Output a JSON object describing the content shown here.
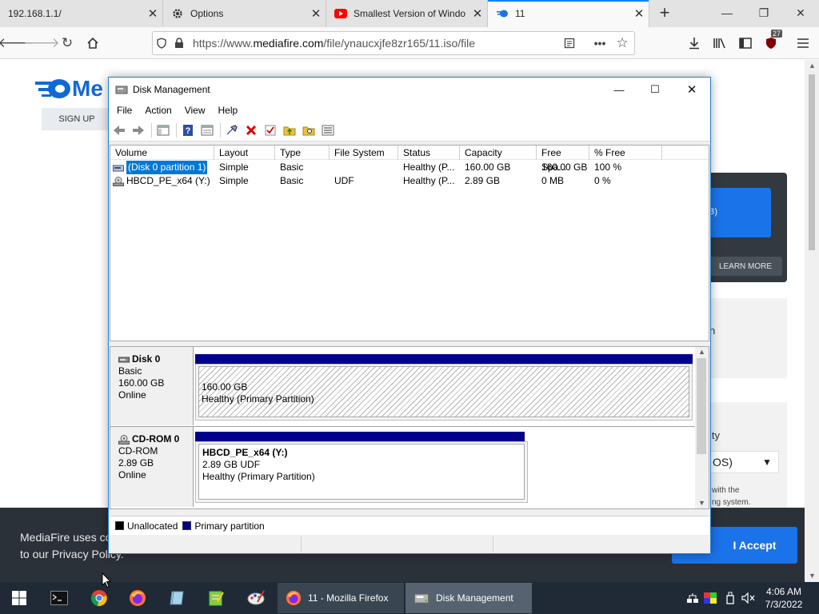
{
  "browser": {
    "tabs": [
      {
        "title": "192.168.1.1/",
        "active": false
      },
      {
        "title": "Options",
        "active": false
      },
      {
        "title": "Smallest Version of Windo",
        "active": false
      },
      {
        "title": "11",
        "active": true
      }
    ],
    "url_prefix": "https://www.",
    "url_host": "mediafire.com",
    "url_path": "/file/ynaucxjfe8zr165/11.iso/file",
    "extension_badge": "27"
  },
  "page": {
    "logo": "Me",
    "signup": "SIGN UP",
    "download_suffix": "B)",
    "learn_more": "LEARN MORE",
    "side_h": "h",
    "side_ity": "ity",
    "os_select": "OS)",
    "side_small_1": "with the",
    "side_small_2": "ng system.",
    "cookie_line1": "MediaFire uses coo",
    "cookie_line2": "to our Privacy Policy.",
    "accept": "I Accept"
  },
  "dm": {
    "title": "Disk Management",
    "menu": [
      "File",
      "Action",
      "View",
      "Help"
    ],
    "columns": [
      "Volume",
      "Layout",
      "Type",
      "File System",
      "Status",
      "Capacity",
      "Free Spa...",
      "% Free"
    ],
    "volumes": [
      {
        "volume": "(Disk 0 partition 1)",
        "layout": "Simple",
        "type": "Basic",
        "fs": "",
        "status": "Healthy (P...",
        "capacity": "160.00 GB",
        "free": "160.00 GB",
        "pct": "100 %"
      },
      {
        "volume": "HBCD_PE_x64 (Y:)",
        "layout": "Simple",
        "type": "Basic",
        "fs": "UDF",
        "status": "Healthy (P...",
        "capacity": "2.89 GB",
        "free": "0 MB",
        "pct": "0 %"
      }
    ],
    "disk0": {
      "name": "Disk 0",
      "kind": "Basic",
      "size": "160.00 GB",
      "state": "Online",
      "partition_size": "160.00 GB",
      "partition_status": "Healthy (Primary Partition)"
    },
    "cdrom0": {
      "name": "CD-ROM 0",
      "kind": "CD-ROM",
      "size": "2.89 GB",
      "state": "Online",
      "partition_name": "HBCD_PE_x64  (Y:)",
      "partition_size": "2.89 GB UDF",
      "partition_status": "Healthy (Primary Partition)"
    },
    "legend": [
      {
        "label": "Unallocated",
        "color": "#000000"
      },
      {
        "label": "Primary partition",
        "color": "#00008b"
      }
    ]
  },
  "taskbar": {
    "tasks": [
      {
        "label": "11 - Mozilla Firefox"
      },
      {
        "label": "Disk Management"
      }
    ],
    "time": "4:06 AM",
    "date": "7/3/2022"
  }
}
